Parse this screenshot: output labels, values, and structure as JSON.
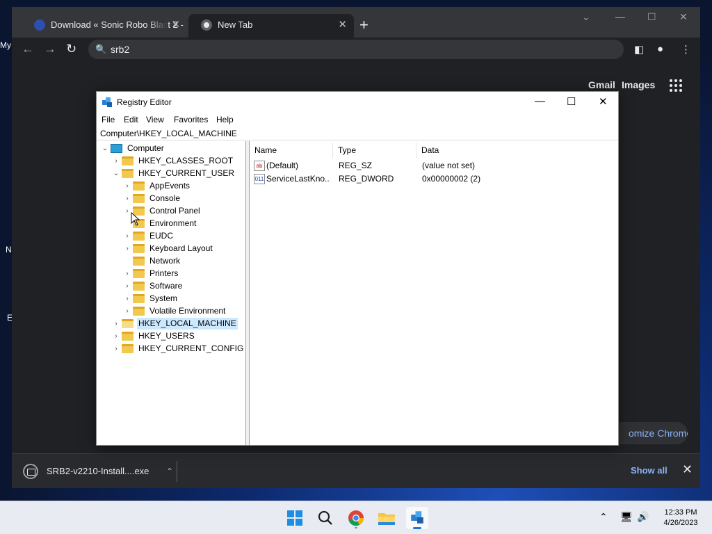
{
  "desktop": {
    "icon_labels": [
      "My",
      "N",
      "E"
    ]
  },
  "chrome": {
    "tabs": [
      {
        "title": "Download « Sonic Robo Blast 2 - ",
        "active": false
      },
      {
        "title": "New Tab",
        "active": true
      }
    ],
    "new_tab": "+",
    "omnibox": {
      "value": "srb2"
    },
    "new_tab_page": {
      "links": [
        "Gmail",
        "Images"
      ],
      "customize": "Customize Chrome",
      "customize_visible": "omize Chrome"
    },
    "download_bar": {
      "file": "SRB2-v2210-Install....exe",
      "show_all": "Show all"
    }
  },
  "regedit": {
    "title": "Registry Editor",
    "menu": [
      "File",
      "Edit",
      "View",
      "Favorites",
      "Help"
    ],
    "address": "Computer\\HKEY_LOCAL_MACHINE",
    "tree": {
      "root": "Computer",
      "hives": [
        "HKEY_CLASSES_ROOT",
        "HKEY_CURRENT_USER",
        "HKEY_LOCAL_MACHINE",
        "HKEY_USERS",
        "HKEY_CURRENT_CONFIG"
      ],
      "current_user_children": [
        "AppEvents",
        "Console",
        "Control Panel",
        "Environment",
        "EUDC",
        "Keyboard Layout",
        "Network",
        "Printers",
        "Software",
        "System",
        "Volatile Environment"
      ],
      "selected": "HKEY_LOCAL_MACHINE"
    },
    "columns": [
      "Name",
      "Type",
      "Data"
    ],
    "values": [
      {
        "name": "(Default)",
        "type": "REG_SZ",
        "data": "(value not set)",
        "icon": "string-value-icon"
      },
      {
        "name": "ServiceLastKno...",
        "type": "REG_DWORD",
        "data": "0x00000002 (2)",
        "icon": "binary-value-icon"
      }
    ]
  },
  "taskbar": {
    "time": "12:33 PM",
    "date": "4/26/2023",
    "apps": [
      "start",
      "search",
      "chrome",
      "file-explorer",
      "registry-editor"
    ]
  }
}
